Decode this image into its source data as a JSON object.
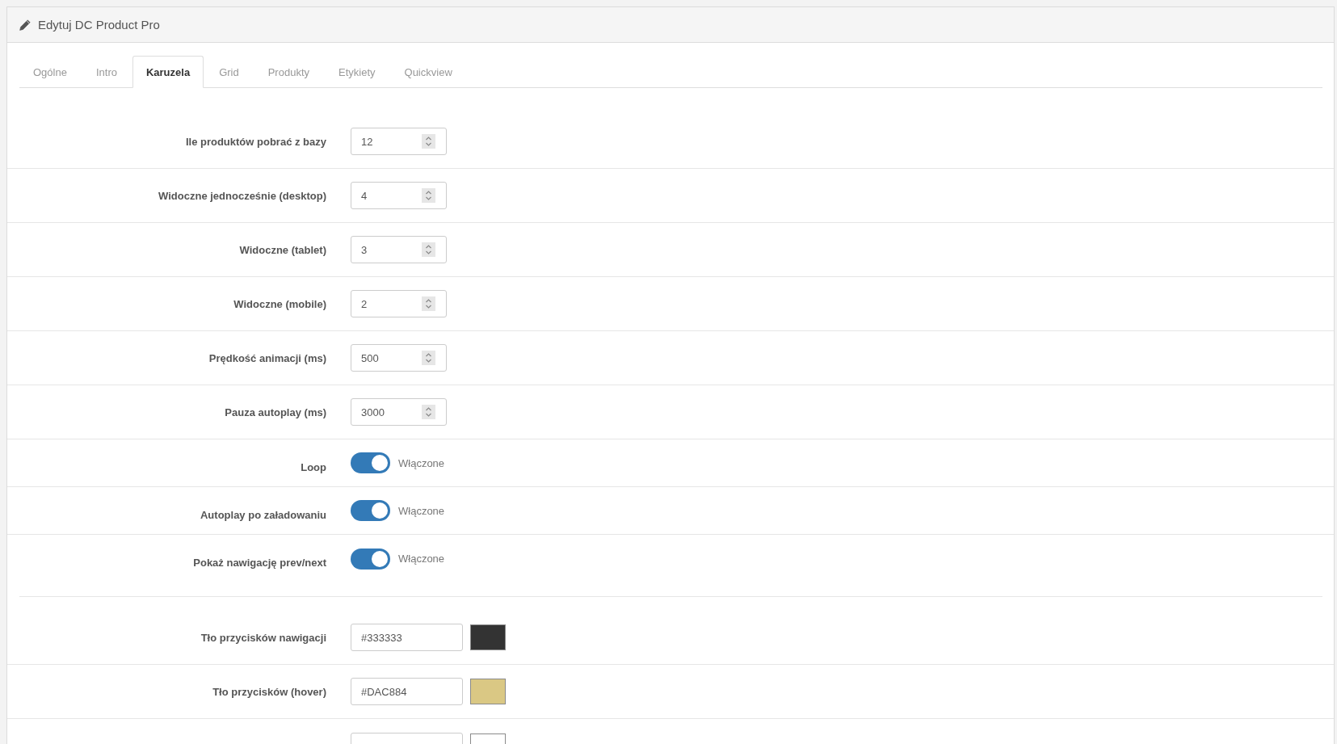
{
  "panel": {
    "title": "Edytuj DC Product Pro"
  },
  "tabs": [
    {
      "label": "Ogólne",
      "selected": false
    },
    {
      "label": "Intro",
      "selected": false
    },
    {
      "label": "Karuzela",
      "selected": true
    },
    {
      "label": "Grid",
      "selected": false
    },
    {
      "label": "Produkty",
      "selected": false
    },
    {
      "label": "Etykiety",
      "selected": false
    },
    {
      "label": "Quickview",
      "selected": false
    }
  ],
  "sections": [
    {
      "fields": [
        {
          "kind": "number",
          "label": "Ile produktów pobrać z bazy",
          "value": "12"
        },
        {
          "kind": "number",
          "label": "Widoczne jednocześnie (desktop)",
          "value": "4"
        },
        {
          "kind": "number",
          "label": "Widoczne (tablet)",
          "value": "3"
        },
        {
          "kind": "number",
          "label": "Widoczne (mobile)",
          "value": "2"
        },
        {
          "kind": "number",
          "label": "Prędkość animacji (ms)",
          "value": "500"
        },
        {
          "kind": "number",
          "label": "Pauza autoplay (ms)",
          "value": "3000"
        },
        {
          "kind": "toggle",
          "label": "Loop",
          "on": true,
          "state_label": "Włączone"
        },
        {
          "kind": "toggle",
          "label": "Autoplay po załadowaniu",
          "on": true,
          "state_label": "Włączone"
        },
        {
          "kind": "toggle",
          "label": "Pokaż nawigację prev/next",
          "on": true,
          "state_label": "Włączone"
        }
      ]
    },
    {
      "fields": [
        {
          "kind": "color",
          "label": "Tło przycisków nawigacji",
          "value": "#333333",
          "color": "#333333"
        },
        {
          "kind": "color",
          "label": "Tło przycisków (hover)",
          "value": "#DAC884",
          "color": "#dac884"
        },
        {
          "kind": "color",
          "color": "#ffffff"
        }
      ]
    }
  ]
}
